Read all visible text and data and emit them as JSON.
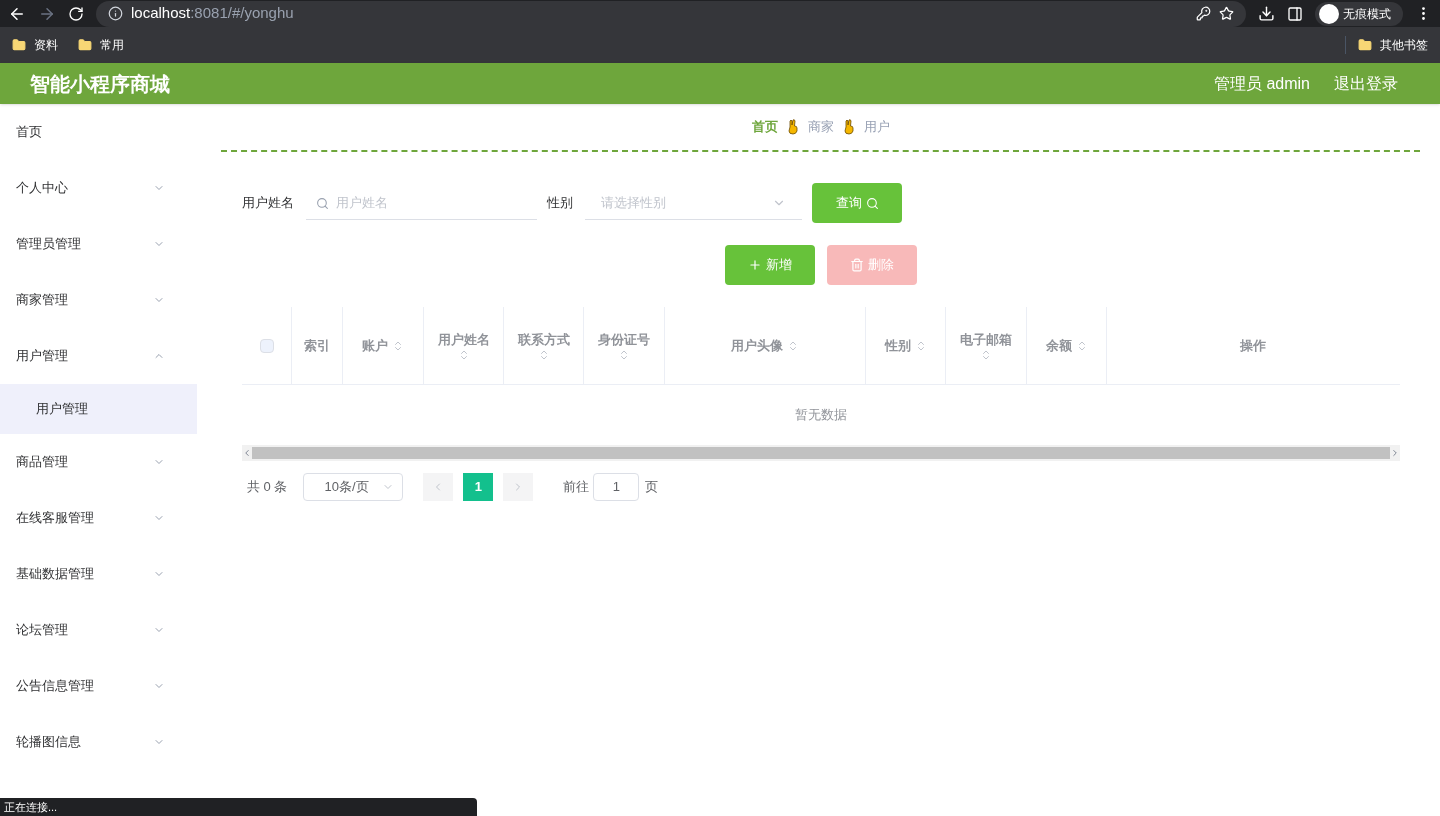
{
  "browser": {
    "url_host": "localhost",
    "url_rest": ":8081/#/yonghu",
    "incognito_label": "无痕模式",
    "bookmarks": [
      "资料",
      "常用"
    ],
    "other_bookmarks": "其他书签"
  },
  "header": {
    "title": "智能小程序商城",
    "user": "管理员 admin",
    "logout": "退出登录"
  },
  "sidebar": {
    "items": [
      {
        "label": "首页",
        "expandable": false
      },
      {
        "label": "个人中心",
        "expandable": true,
        "expanded": false
      },
      {
        "label": "管理员管理",
        "expandable": true,
        "expanded": false
      },
      {
        "label": "商家管理",
        "expandable": true,
        "expanded": false
      },
      {
        "label": "用户管理",
        "expandable": true,
        "expanded": true,
        "children": [
          {
            "label": "用户管理",
            "selected": true
          }
        ]
      },
      {
        "label": "商品管理",
        "expandable": true,
        "expanded": false
      },
      {
        "label": "在线客服管理",
        "expandable": true,
        "expanded": false
      },
      {
        "label": "基础数据管理",
        "expandable": true,
        "expanded": false
      },
      {
        "label": "论坛管理",
        "expandable": true,
        "expanded": false
      },
      {
        "label": "公告信息管理",
        "expandable": true,
        "expanded": false
      },
      {
        "label": "轮播图信息",
        "expandable": true,
        "expanded": false
      }
    ]
  },
  "breadcrumb": [
    {
      "label": "首页",
      "current": false
    },
    {
      "label": "商家",
      "current": true
    },
    {
      "label": "用户",
      "current": true
    }
  ],
  "search": {
    "name_label": "用户姓名",
    "name_placeholder": "用户姓名",
    "gender_label": "性别",
    "gender_placeholder": "请选择性别",
    "query_button": "查询"
  },
  "actions": [
    {
      "kind": "add",
      "label": "新增",
      "disabled": false
    },
    {
      "kind": "delete",
      "label": "删除",
      "disabled": true
    }
  ],
  "table": {
    "select_all_checked": false,
    "columns": [
      {
        "label": "索引",
        "sortable": false
      },
      {
        "label": "账户",
        "sortable": true
      },
      {
        "label": "用户姓名",
        "sortable": true
      },
      {
        "label": "联系方式",
        "sortable": true
      },
      {
        "label": "身份证号",
        "sortable": true
      },
      {
        "label": "用户头像",
        "sortable": true
      },
      {
        "label": "性别",
        "sortable": true
      },
      {
        "label": "电子邮箱",
        "sortable": true
      },
      {
        "label": "余额",
        "sortable": true
      },
      {
        "label": "操作",
        "sortable": false
      }
    ],
    "empty_text": "暂无数据"
  },
  "pagination": {
    "total": "共 0 条",
    "page_size": "10条/页",
    "pages": [
      {
        "label": "1",
        "selected": true
      }
    ],
    "goto_label": "前往",
    "goto_value": "1",
    "goto_suffix": "页"
  },
  "status_text": "正在连接..."
}
